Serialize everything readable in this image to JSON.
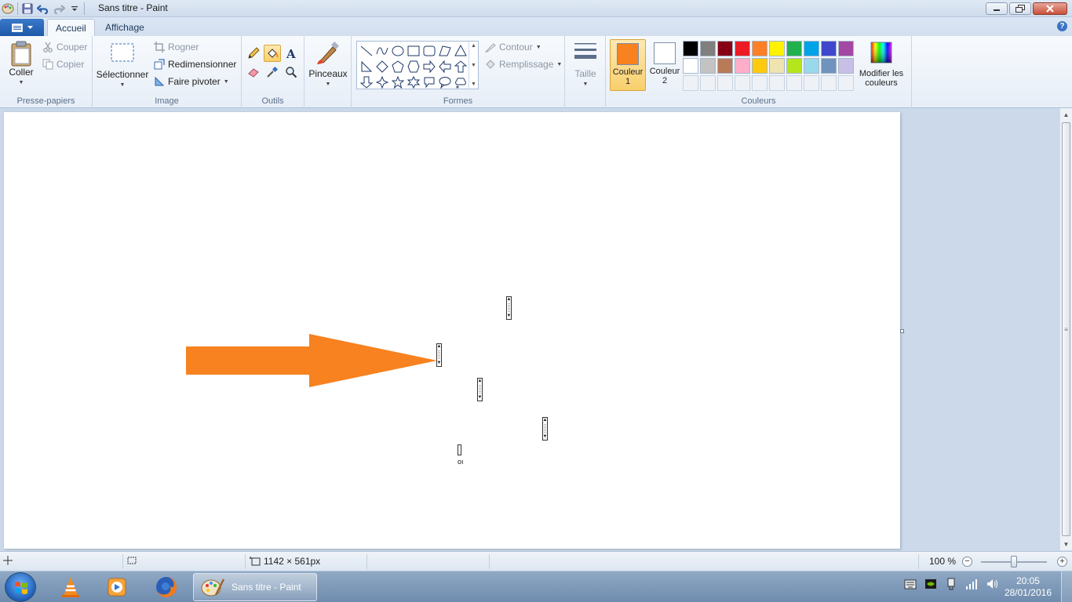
{
  "window": {
    "title": "Sans titre - Paint"
  },
  "tabs": {
    "home": "Accueil",
    "view": "Affichage"
  },
  "clipboard": {
    "paste": "Coller",
    "cut": "Couper",
    "copy": "Copier",
    "label": "Presse-papiers"
  },
  "image": {
    "select": "Sélectionner",
    "crop": "Rogner",
    "resize": "Redimensionner",
    "rotate": "Faire pivoter",
    "label": "Image"
  },
  "tools": {
    "label": "Outils",
    "selected": "fill-bucket"
  },
  "brushes": {
    "label": "Pinceaux"
  },
  "shapes": {
    "outline": "Contour",
    "fill": "Remplissage",
    "label": "Formes"
  },
  "size": {
    "label": "Taille"
  },
  "colors": {
    "color1_label": "Couleur",
    "color1_num": "1",
    "color2_label": "Couleur",
    "color2_num": "2",
    "color1": "#f7821f",
    "color2": "#ffffff",
    "edit": "Modifier les couleurs",
    "label": "Couleurs",
    "palette_row1": [
      "#000000",
      "#7f7f7f",
      "#880015",
      "#ed1c24",
      "#ff7f27",
      "#fff200",
      "#22b14c",
      "#00a2e8",
      "#3f48cc",
      "#a349a4"
    ],
    "palette_row2": [
      "#ffffff",
      "#c3c3c3",
      "#b97a57",
      "#ffaec9",
      "#ffc90e",
      "#efe4b0",
      "#b5e61d",
      "#99d9ea",
      "#7092be",
      "#c8bfe7"
    ]
  },
  "canvas": {
    "stray_text": "oı",
    "arrow_color": "#f7821f"
  },
  "status": {
    "dimensions": "1142 × 561px",
    "zoom": "100 %"
  },
  "taskbar": {
    "active_app": "Sans titre - Paint",
    "time": "20:05",
    "date": "28/01/2016"
  }
}
